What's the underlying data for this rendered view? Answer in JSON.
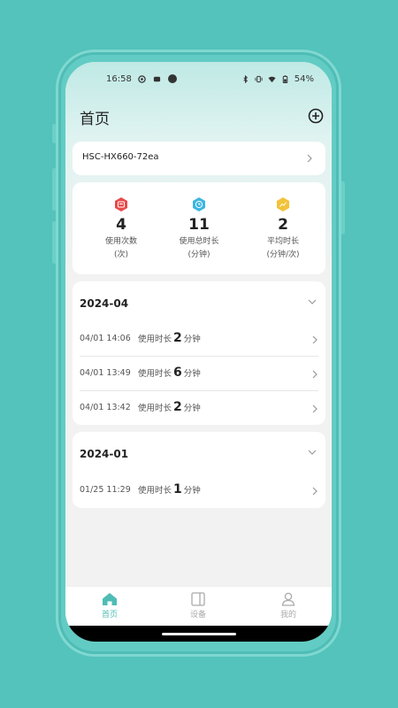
{
  "status_bar": {
    "time": "16:58",
    "battery": "54%"
  },
  "header": {
    "title": "首页"
  },
  "device": {
    "name": "HSC-HX660-72ea"
  },
  "stats": [
    {
      "value": "4",
      "label_line1": "使用次数",
      "label_line2": "(次)",
      "color": "#e84a4a"
    },
    {
      "value": "11",
      "label_line1": "使用总时长",
      "label_line2": "(分钟)",
      "color": "#3db6e0"
    },
    {
      "value": "2",
      "label_line1": "平均时长",
      "label_line2": "(分钟/次)",
      "color": "#f2c23a"
    }
  ],
  "months": [
    {
      "title": "2024-04",
      "records": [
        {
          "datetime": "04/01 14:06",
          "prefix": "使用时长",
          "minutes": "2",
          "unit": "分钟"
        },
        {
          "datetime": "04/01 13:49",
          "prefix": "使用时长",
          "minutes": "6",
          "unit": "分钟"
        },
        {
          "datetime": "04/01 13:42",
          "prefix": "使用时长",
          "minutes": "2",
          "unit": "分钟"
        }
      ]
    },
    {
      "title": "2024-01",
      "records": [
        {
          "datetime": "01/25 11:29",
          "prefix": "使用时长",
          "minutes": "1",
          "unit": "分钟"
        }
      ]
    }
  ],
  "tabs": [
    {
      "label": "首页",
      "icon": "home-icon",
      "active": true
    },
    {
      "label": "设备",
      "icon": "device-icon",
      "active": false
    },
    {
      "label": "我的",
      "icon": "profile-icon",
      "active": false
    }
  ],
  "colors": {
    "accent": "#4fbdb5",
    "background": "#53c3bb"
  }
}
